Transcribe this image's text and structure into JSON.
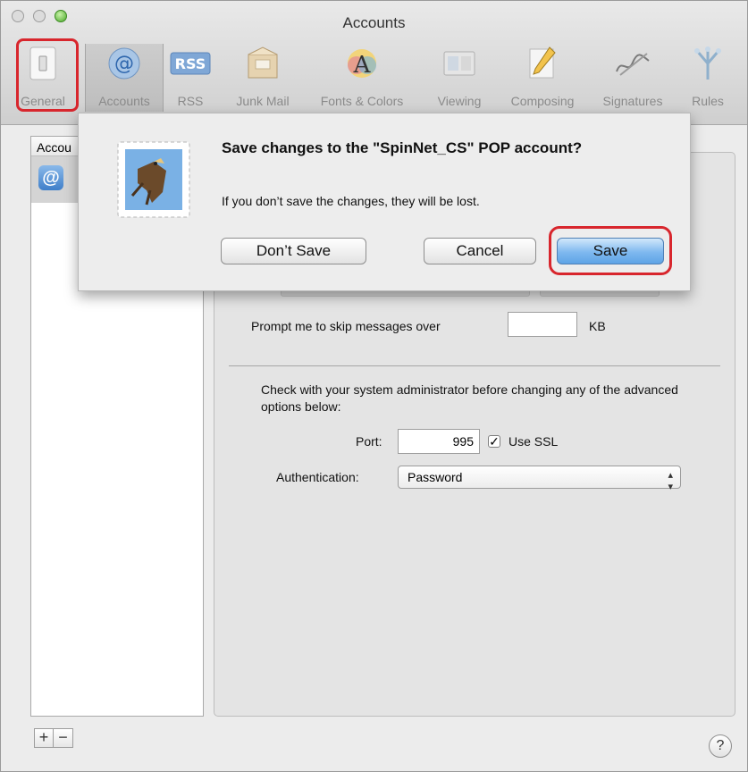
{
  "window": {
    "title": "Accounts"
  },
  "toolbar": {
    "items": [
      {
        "label": "General",
        "icon": "light-switch-icon"
      },
      {
        "label": "Accounts",
        "icon": "at-sign-icon"
      },
      {
        "label": "RSS",
        "icon": "rss-icon"
      },
      {
        "label": "Junk Mail",
        "icon": "junk-mail-icon"
      },
      {
        "label": "Fonts & Colors",
        "icon": "fonts-colors-icon"
      },
      {
        "label": "Viewing",
        "icon": "viewing-icon"
      },
      {
        "label": "Composing",
        "icon": "pencil-icon"
      },
      {
        "label": "Signatures",
        "icon": "signature-icon"
      },
      {
        "label": "Rules",
        "icon": "rules-icon"
      }
    ],
    "selected": "Accounts"
  },
  "sidebar": {
    "header": "Accou"
  },
  "advanced": {
    "prompt_label": "Prompt me to skip messages over",
    "prompt_value": "",
    "prompt_unit": "KB",
    "note": "Check with your system administrator before changing any of the advanced options below:",
    "port_label": "Port:",
    "port_value": "995",
    "ssl_label": "Use SSL",
    "ssl_checked": true,
    "auth_label": "Authentication:",
    "auth_value": "Password"
  },
  "bottom": {
    "add": "+",
    "remove": "−",
    "help": "?"
  },
  "dialog": {
    "title": "Save changes to the \"SpinNet_CS\" POP account?",
    "message": "If you don’t save the changes, they will be lost.",
    "dont_save": "Don’t Save",
    "cancel": "Cancel",
    "save": "Save"
  },
  "colors": {
    "highlight_ring": "#d8262d",
    "default_button": "#5ea4e6"
  }
}
